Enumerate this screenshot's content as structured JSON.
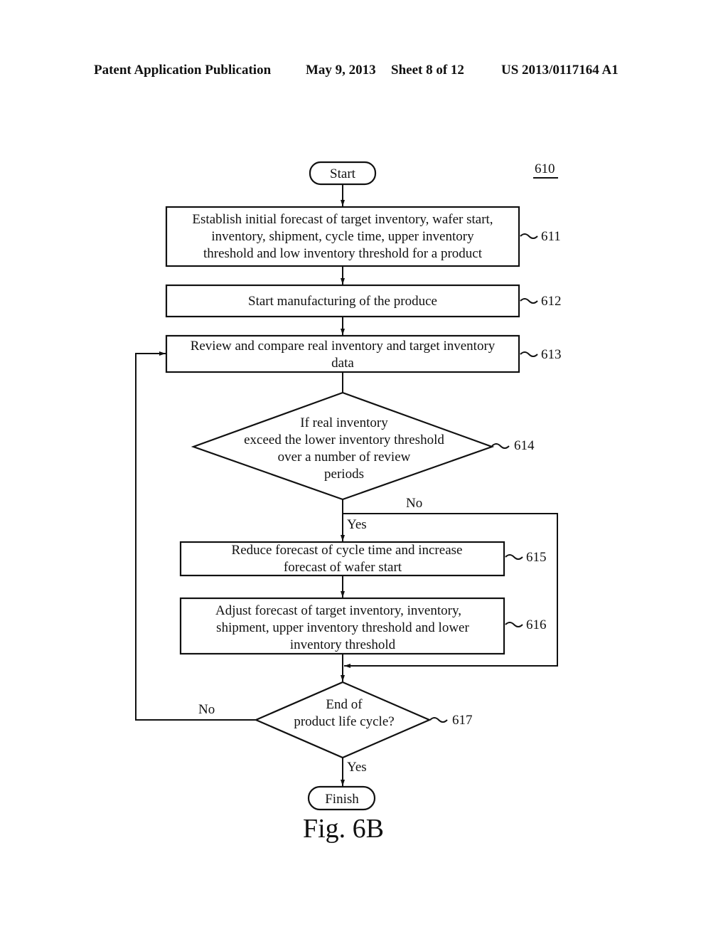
{
  "header": {
    "publication": "Patent Application Publication",
    "date": "May 9, 2013",
    "sheet": "Sheet 8 of 12",
    "number": "US 2013/0117164 A1"
  },
  "figure": {
    "ref": "610",
    "caption": "Fig. 6B",
    "start": "Start",
    "finish": "Finish",
    "steps": [
      {
        "ref": "611",
        "lines": [
          "Establish initial forecast of target inventory, wafer start,",
          "inventory, shipment, cycle time, upper inventory",
          "threshold and low inventory threshold for a product"
        ]
      },
      {
        "ref": "612",
        "lines": [
          "Start manufacturing of the produce"
        ]
      },
      {
        "ref": "613",
        "lines": [
          "Review and compare real inventory and target inventory",
          "data"
        ]
      },
      {
        "ref": "614",
        "lines": [
          "If real inventory",
          "exceed the lower inventory threshold",
          "over a number of review",
          "periods"
        ]
      },
      {
        "ref": "615",
        "lines": [
          "Reduce forecast of cycle time and increase",
          "forecast of wafer start"
        ]
      },
      {
        "ref": "616",
        "lines": [
          "Adjust forecast of target inventory, inventory,",
          "shipment, upper inventory threshold and lower",
          "inventory threshold"
        ]
      },
      {
        "ref": "617",
        "lines": [
          "End of",
          "product life cycle?"
        ]
      }
    ],
    "branches": {
      "d614_no": "No",
      "d614_yes": "Yes",
      "d617_no": "No",
      "d617_yes": "Yes"
    }
  }
}
